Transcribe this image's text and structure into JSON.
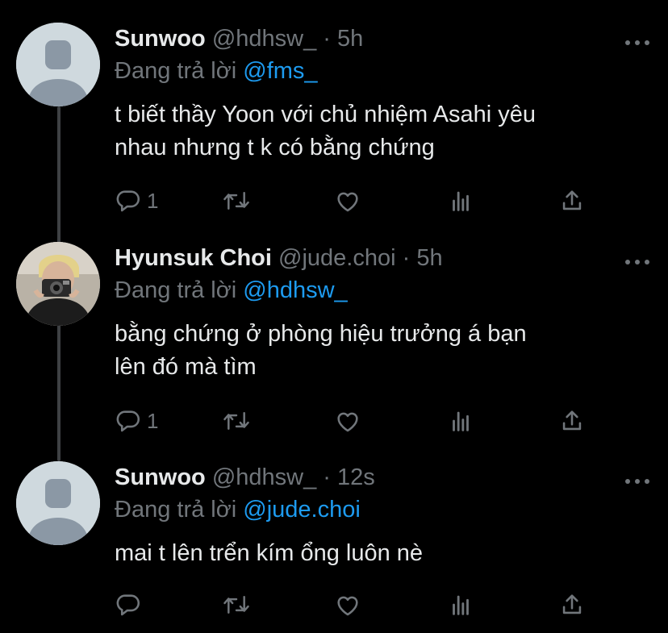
{
  "tweets": [
    {
      "name": "Sunwoo",
      "handle": "@hdhsw_",
      "separator": "·",
      "time": "5h",
      "reply_prefix": "Đang trả lời",
      "reply_to": "@fms_",
      "text": "t biết thầy Yoon với chủ nhiệm Asahi yêu\nnhau nhưng t k có bằng chứng",
      "reply_count": "1",
      "avatar": "default-avatar"
    },
    {
      "name": "Hyunsuk Choi",
      "handle": "@jude.choi",
      "separator": "·",
      "time": "5h",
      "reply_prefix": "Đang trả lời",
      "reply_to": "@hdhsw_",
      "text": "bằng chứng ở phòng hiệu trưởng á bạn\nlên đó mà tìm",
      "reply_count": "1",
      "avatar": "photo-avatar"
    },
    {
      "name": "Sunwoo",
      "handle": "@hdhsw_",
      "separator": "·",
      "time": "12s",
      "reply_prefix": "Đang trả lời",
      "reply_to": "@jude.choi",
      "text": "mai t lên trển kím ổng luôn nè",
      "reply_count": "",
      "avatar": "default-avatar"
    }
  ],
  "icons": {
    "reply": "reply-icon",
    "retweet": "retweet-icon",
    "like": "like-icon",
    "views": "views-icon",
    "share": "share-icon",
    "more": "more-icon"
  },
  "colors": {
    "background": "#000000",
    "text": "#e7e9ea",
    "muted": "#71767b",
    "accent": "#1d9bf0",
    "thread_line": "#3e4144",
    "default_avatar_bg": "#cfd9de",
    "default_avatar_fg": "#8b98a5"
  }
}
